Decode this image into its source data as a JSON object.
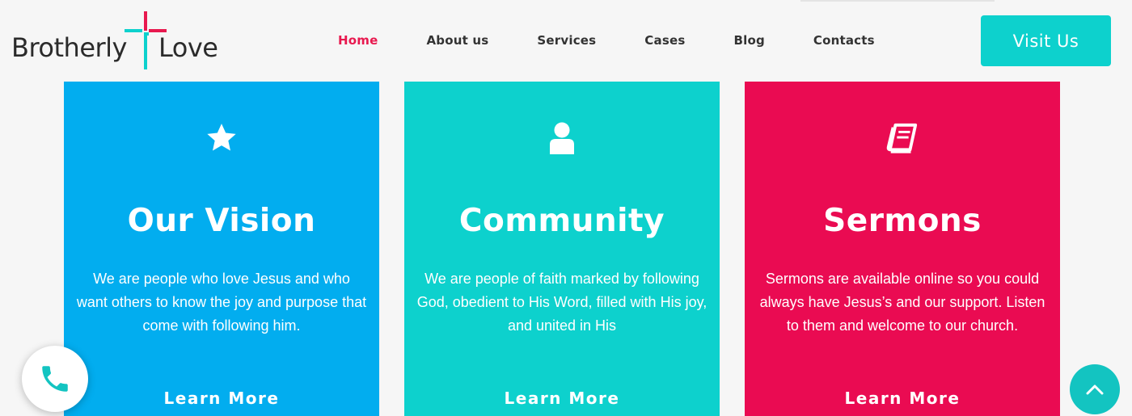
{
  "brand": {
    "name_part1": "Brotherly",
    "name_part2": "Love",
    "cross_color_pink": "#e8194f",
    "cross_color_teal": "#0dd1cd"
  },
  "nav": {
    "items": [
      {
        "label": "Home",
        "active": true
      },
      {
        "label": "About us",
        "active": false
      },
      {
        "label": "Services",
        "active": false
      },
      {
        "label": "Cases",
        "active": false
      },
      {
        "label": "Blog",
        "active": false
      },
      {
        "label": "Contacts",
        "active": false
      }
    ],
    "active_color": "#e8194f"
  },
  "header": {
    "cta_label": "Visit Us",
    "cta_color": "#0dd1cd"
  },
  "cards": [
    {
      "icon": "star-icon",
      "title": "Our Vision",
      "text": "We are people who love Jesus and who want others to know the joy and purpose that come with following him.",
      "link": "Learn More",
      "color": "#02adef"
    },
    {
      "icon": "user-icon",
      "title": "Community",
      "text": "We are people of faith marked by following God, obedient to His Word, filled with His joy, and united in His",
      "link": "Learn More",
      "color": "#0dd1cd"
    },
    {
      "icon": "book-icon",
      "title": "Sermons",
      "text": "Sermons are available online so you could always have Jesus’s and our support. Listen to them and welcome to our church.",
      "link": "Learn More",
      "color": "#ea0b52"
    }
  ],
  "floating": {
    "phone_icon": "phone-icon",
    "scroll_top_icon": "chevron-up-icon"
  }
}
